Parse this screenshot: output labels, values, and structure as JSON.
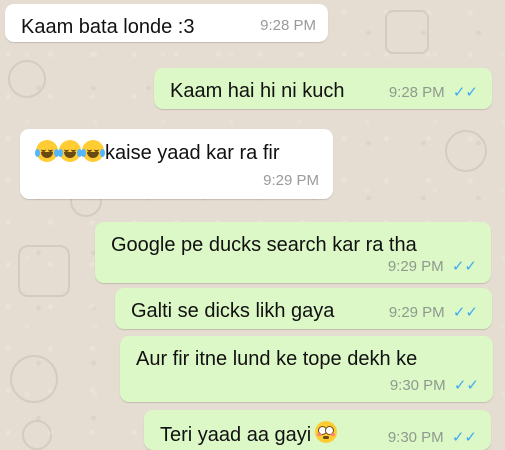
{
  "colors": {
    "chat_background": "#e5ddd1",
    "incoming_bubble": "#ffffff",
    "outgoing_bubble": "#dcf8c6",
    "read_tick": "#3fa9f5"
  },
  "messages": [
    {
      "direction": "incoming",
      "text": "Kaam bata londe :3",
      "time": "9:28 PM"
    },
    {
      "direction": "outgoing",
      "text": "Kaam hai hi ni kuch",
      "time": "9:28 PM",
      "status": "read",
      "ticks": "✓✓"
    },
    {
      "direction": "incoming",
      "emoji": [
        "face-with-tears-of-joy-icon",
        "face-with-tears-of-joy-icon",
        "face-with-tears-of-joy-icon"
      ],
      "text": "kaise yaad kar ra fir",
      "time": "9:29 PM"
    },
    {
      "direction": "outgoing",
      "text": "Google pe ducks search kar ra tha",
      "time": "9:29 PM",
      "status": "read",
      "ticks": "✓✓"
    },
    {
      "direction": "outgoing",
      "text": "Galti se dicks likh gaya",
      "time": "9:29 PM",
      "status": "read",
      "ticks": "✓✓"
    },
    {
      "direction": "outgoing",
      "text": "Aur fir itne lund ke tope dekh ke",
      "time": "9:30 PM",
      "status": "read",
      "ticks": "✓✓"
    },
    {
      "direction": "outgoing",
      "text": "Teri yaad aa gayi",
      "emoji_after": "flushed-face-icon",
      "time": "9:30 PM",
      "status": "read",
      "ticks": "✓✓"
    }
  ]
}
